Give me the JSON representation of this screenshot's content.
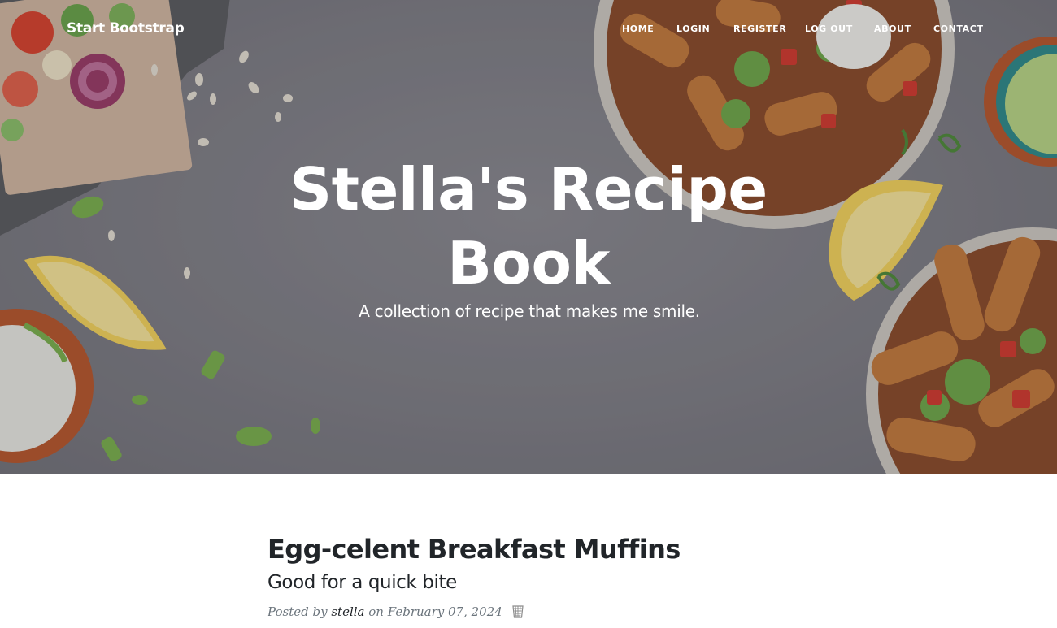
{
  "brand": "Start Bootstrap",
  "nav": {
    "items": [
      {
        "label": "HOME"
      },
      {
        "label": "LOGIN"
      },
      {
        "label": "REGISTER"
      },
      {
        "label": "LOG OUT"
      },
      {
        "label": "ABOUT"
      },
      {
        "label": "CONTACT"
      }
    ]
  },
  "hero": {
    "title": "Stella's Recipe Book",
    "subtitle": "A collection of recipe that makes me smile."
  },
  "posts": [
    {
      "title": "Egg-celent Breakfast Muffins",
      "subtitle": "Good for a quick bite",
      "meta_prefix": "Posted by",
      "author": "stella",
      "meta_on": "on",
      "date": "February 07, 2024",
      "delete_icon": "trash-icon"
    }
  ],
  "colors": {
    "text_dark": "#212529",
    "text_muted": "#6c757d",
    "hero_overlay": "#808087"
  }
}
